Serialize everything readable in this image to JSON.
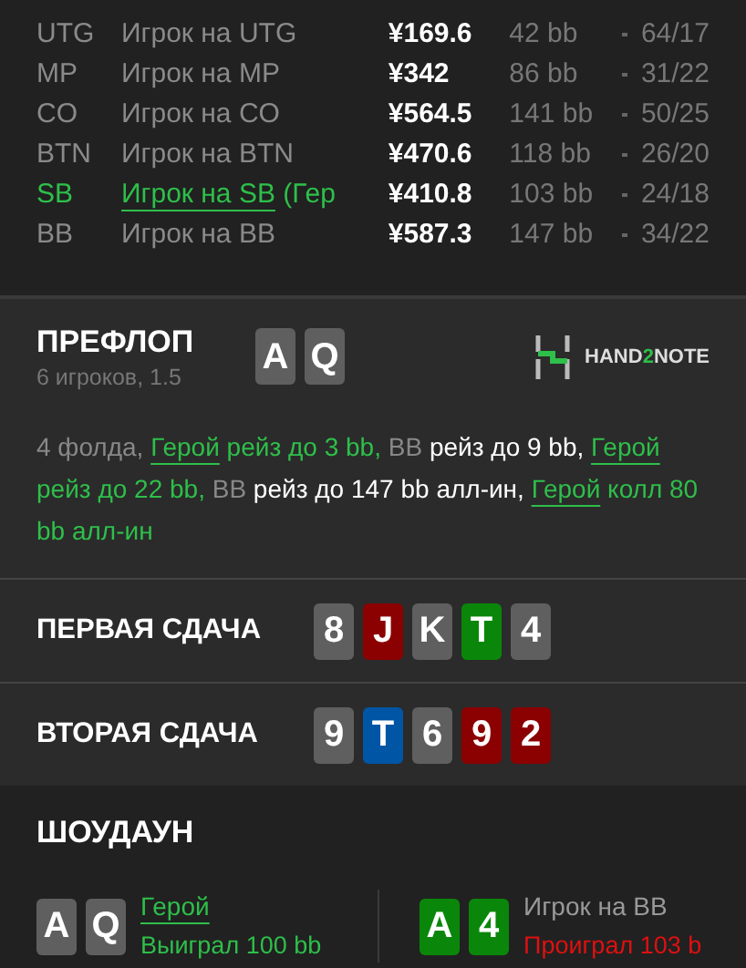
{
  "players": [
    {
      "position": "UTG",
      "name": "Игрок на UTG",
      "hero": false,
      "stack": "¥169.6",
      "bb": "42 bb",
      "stats": "64/17"
    },
    {
      "position": "MP",
      "name": "Игрок на MP",
      "hero": false,
      "stack": "¥342",
      "bb": "86 bb",
      "stats": "31/22"
    },
    {
      "position": "CO",
      "name": "Игрок на CO",
      "hero": false,
      "stack": "¥564.5",
      "bb": "141 bb",
      "stats": "50/25"
    },
    {
      "position": "BTN",
      "name": "Игрок на BTN",
      "hero": false,
      "stack": "¥470.6",
      "bb": "118 bb",
      "stats": "26/20"
    },
    {
      "position": "SB",
      "name": "Игрок на SB",
      "name_suffix": " (Гер",
      "hero": true,
      "stack": "¥410.8",
      "bb": "103 bb",
      "stats": "24/18"
    },
    {
      "position": "BB",
      "name": "Игрок на BB",
      "hero": false,
      "stack": "¥587.3",
      "bb": "147 bb",
      "stats": "34/22"
    }
  ],
  "preflop": {
    "title": "ПРЕФЛОП",
    "subtitle": "6 игроков, 1.5",
    "cards": [
      {
        "rank": "A",
        "color": "#5f5f5f"
      },
      {
        "rank": "Q",
        "color": "#5f5f5f"
      }
    ],
    "logo": {
      "before": "HAND",
      "accent": "2",
      "after": "NOTE"
    },
    "actions": [
      {
        "text": "4 фолда, ",
        "kind": "info"
      },
      {
        "text": "Герой",
        "kind": "hero"
      },
      {
        "text": " рейз до 3 bb, ",
        "kind": "hero-action"
      },
      {
        "text": "BB",
        "kind": "player"
      },
      {
        "text": " рейз до 9 bb, ",
        "kind": "action"
      },
      {
        "text": "Герой",
        "kind": "hero"
      },
      {
        "text": " рейз до 22 bb, ",
        "kind": "hero-action"
      },
      {
        "text": "BB",
        "kind": "player"
      },
      {
        "text": " рейз до 147 bb алл-ин, ",
        "kind": "action"
      },
      {
        "text": "Герой",
        "kind": "hero"
      },
      {
        "text": " колл 80 bb алл-ин",
        "kind": "hero-action"
      }
    ]
  },
  "boards": [
    {
      "title": "ПЕРВАЯ СДАЧА",
      "cards": [
        {
          "rank": "8",
          "color": "#5f5f5f"
        },
        {
          "rank": "J",
          "color": "#8b0000"
        },
        {
          "rank": "K",
          "color": "#5f5f5f"
        },
        {
          "rank": "T",
          "color": "#0a870a"
        },
        {
          "rank": "4",
          "color": "#5f5f5f"
        }
      ]
    },
    {
      "title": "ВТОРАЯ СДАЧА",
      "cards": [
        {
          "rank": "9",
          "color": "#5f5f5f"
        },
        {
          "rank": "T",
          "color": "#0055a4"
        },
        {
          "rank": "6",
          "color": "#5f5f5f"
        },
        {
          "rank": "9",
          "color": "#8b0000"
        },
        {
          "rank": "2",
          "color": "#8b0000"
        }
      ]
    }
  ],
  "showdown": {
    "title": "ШОУДАУН",
    "hands": [
      {
        "cards": [
          {
            "rank": "A",
            "color": "#5f5f5f"
          },
          {
            "rank": "Q",
            "color": "#5f5f5f"
          }
        ],
        "name": "Герой",
        "hero": true,
        "result": "Выиграл 100 bb",
        "won": true
      },
      {
        "cards": [
          {
            "rank": "A",
            "color": "#0a870a"
          },
          {
            "rank": "4",
            "color": "#0a870a"
          }
        ],
        "name": "Игрок на BB",
        "hero": false,
        "result": "Проиграл 103 b",
        "won": false
      }
    ]
  }
}
